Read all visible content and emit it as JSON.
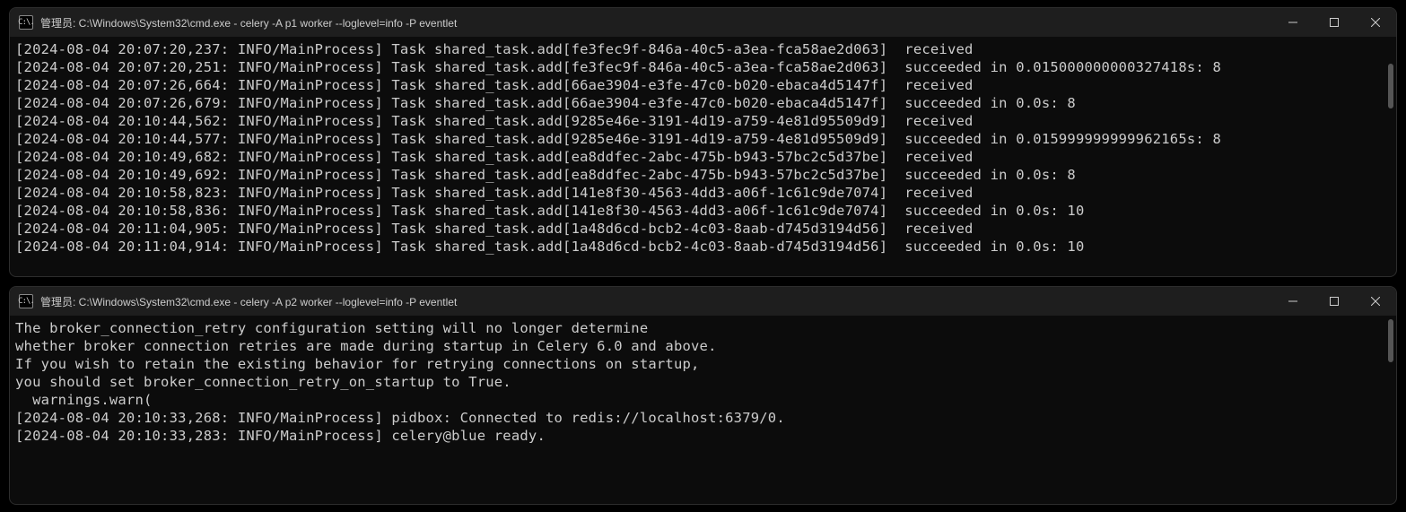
{
  "window1": {
    "title": "管理员: C:\\Windows\\System32\\cmd.exe - celery  -A p1  worker --loglevel=info  -P eventlet",
    "lines": [
      "[2024-08-04 20:07:20,237: INFO/MainProcess] Task shared_task.add[fe3fec9f-846a-40c5-a3ea-fca58ae2d063]  received",
      "[2024-08-04 20:07:20,251: INFO/MainProcess] Task shared_task.add[fe3fec9f-846a-40c5-a3ea-fca58ae2d063]  succeeded in 0.015000000000327418s: 8",
      "[2024-08-04 20:07:26,664: INFO/MainProcess] Task shared_task.add[66ae3904-e3fe-47c0-b020-ebaca4d5147f]  received",
      "[2024-08-04 20:07:26,679: INFO/MainProcess] Task shared_task.add[66ae3904-e3fe-47c0-b020-ebaca4d5147f]  succeeded in 0.0s: 8",
      "[2024-08-04 20:10:44,562: INFO/MainProcess] Task shared_task.add[9285e46e-3191-4d19-a759-4e81d95509d9]  received",
      "[2024-08-04 20:10:44,577: INFO/MainProcess] Task shared_task.add[9285e46e-3191-4d19-a759-4e81d95509d9]  succeeded in 0.015999999999962165s: 8",
      "[2024-08-04 20:10:49,682: INFO/MainProcess] Task shared_task.add[ea8ddfec-2abc-475b-b943-57bc2c5d37be]  received",
      "[2024-08-04 20:10:49,692: INFO/MainProcess] Task shared_task.add[ea8ddfec-2abc-475b-b943-57bc2c5d37be]  succeeded in 0.0s: 8",
      "[2024-08-04 20:10:58,823: INFO/MainProcess] Task shared_task.add[141e8f30-4563-4dd3-a06f-1c61c9de7074]  received",
      "[2024-08-04 20:10:58,836: INFO/MainProcess] Task shared_task.add[141e8f30-4563-4dd3-a06f-1c61c9de7074]  succeeded in 0.0s: 10",
      "[2024-08-04 20:11:04,905: INFO/MainProcess] Task shared_task.add[1a48d6cd-bcb2-4c03-8aab-d745d3194d56]  received",
      "[2024-08-04 20:11:04,914: INFO/MainProcess] Task shared_task.add[1a48d6cd-bcb2-4c03-8aab-d745d3194d56]  succeeded in 0.0s: 10"
    ]
  },
  "window2": {
    "title": "管理员: C:\\Windows\\System32\\cmd.exe - celery  -A p2  worker --loglevel=info  -P eventlet",
    "lines": [
      "The broker_connection_retry configuration setting will no longer determine",
      "whether broker connection retries are made during startup in Celery 6.0 and above.",
      "If you wish to retain the existing behavior for retrying connections on startup,",
      "you should set broker_connection_retry_on_startup to True.",
      "  warnings.warn(",
      "",
      "[2024-08-04 20:10:33,268: INFO/MainProcess] pidbox: Connected to redis://localhost:6379/0.",
      "[2024-08-04 20:10:33,283: INFO/MainProcess] celery@blue ready."
    ]
  },
  "icon_label": "C:\\."
}
